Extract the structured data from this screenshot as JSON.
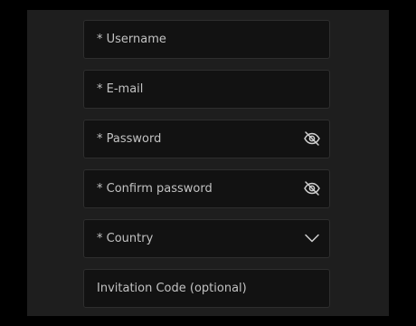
{
  "form": {
    "fields": [
      {
        "label": "* Username",
        "icon": null
      },
      {
        "label": "* E-mail",
        "icon": null
      },
      {
        "label": "* Password",
        "icon": "eye-off-icon"
      },
      {
        "label": "* Confirm password",
        "icon": "eye-off-icon"
      },
      {
        "label": "* Country",
        "icon": "chevron-down-icon"
      },
      {
        "label": "Invitation Code (optional)",
        "icon": null
      }
    ]
  },
  "colors": {
    "background": "#000000",
    "panel": "#1e1e1e",
    "field_background": "#121212",
    "field_border": "#2e2e2e",
    "text": "#c2c2c2",
    "icon": "#cfcfcf"
  }
}
